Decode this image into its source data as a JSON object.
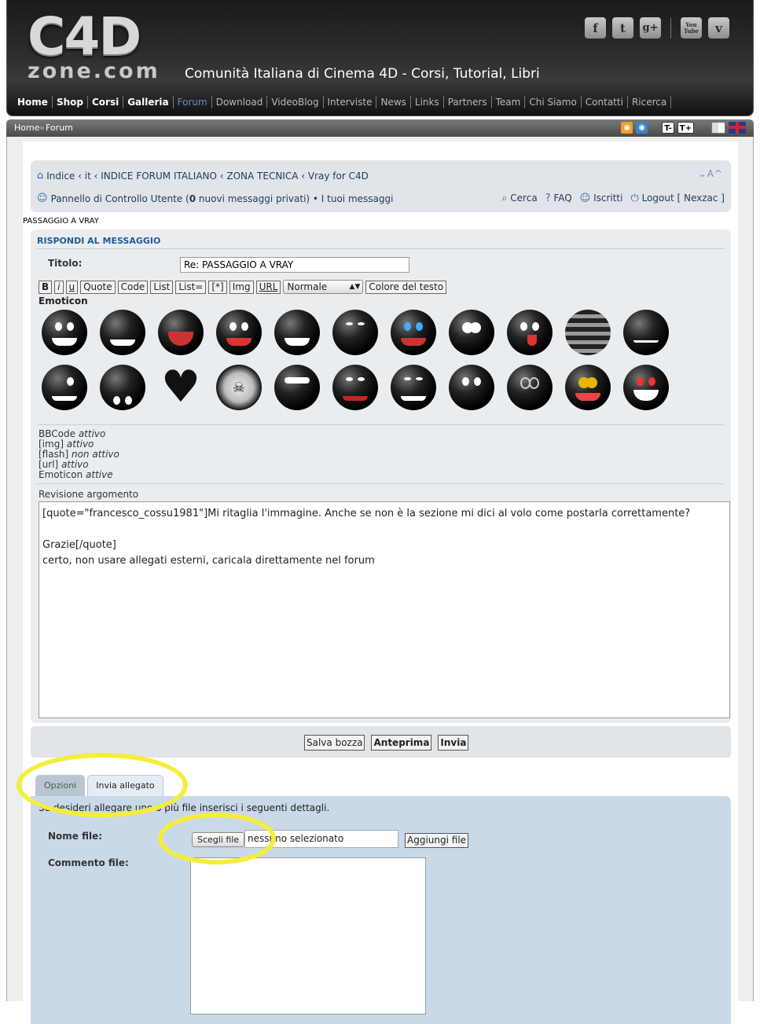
{
  "header": {
    "logo_top": "C4D",
    "logo_bottom": "zone.com",
    "tagline": "Comunità Italiana di Cinema 4D - Corsi, Tutorial, Libri",
    "social": [
      {
        "icon": "facebook-icon",
        "glyph": "f"
      },
      {
        "icon": "twitter-icon",
        "glyph": "t"
      },
      {
        "icon": "googleplus-icon",
        "glyph": "g+"
      },
      {
        "icon": "youtube-icon",
        "glyph": "You Tube"
      },
      {
        "icon": "vimeo-icon",
        "glyph": "v"
      }
    ],
    "nav": [
      "Home",
      "Shop",
      "Corsi",
      "Galleria",
      "Forum",
      "Download",
      "VideoBlog",
      "Interviste",
      "News",
      "Links",
      "Partners",
      "Team",
      "Chi Siamo",
      "Contatti",
      "Ricerca"
    ]
  },
  "crumbbar": {
    "home": "Home",
    "forum": "Forum",
    "text_smaller": "T-",
    "text_larger": "T+"
  },
  "navbar": {
    "breadcrumb": "Indice ‹ it ‹ INDICE FORUM ITALIANO ‹ ZONA TECNICA ‹ Vray for C4D",
    "fontsize_control": "⌄A^",
    "user_panel": "Pannello di Controllo Utente (",
    "pm_count": "0",
    "pm_text": " nuovi messaggi privati) • I tuoi messaggi",
    "search": "Cerca",
    "faq": "FAQ",
    "members": "Iscritti",
    "logout": "Logout [ Nexzac ]"
  },
  "topic_title": "PASSAGGIO A VRAY",
  "post": {
    "heading": "RISPONDI AL MESSAGGIO",
    "title_label": "Titolo:",
    "title_value": "Re: PASSAGGIO A VRAY",
    "bbcode": {
      "b": "B",
      "i": "i",
      "u": "u",
      "quote": "Quote",
      "code": "Code",
      "list": "List",
      "list_eq": "List=",
      "star": "[*]",
      "img": "Img",
      "url": "URL",
      "size": "Normale",
      "color": "Colore del testo"
    },
    "emoticon_label": "Emoticon",
    "status": {
      "bbcode": "BBCode",
      "bbcode_state": "attivo",
      "img": "[img]",
      "img_state": "attivo",
      "flash": "[flash]",
      "flash_state": "non attivo",
      "url": "[url]",
      "url_state": "attivo",
      "emoticon": "Emoticon",
      "emoticon_state": "attive"
    },
    "revision_label": "Revisione argomento",
    "message": "[quote=\"francesco_cossu1981\"]Mi ritaglia l'immagine. Anche se non è la sezione mi dici al volo come postarla correttamente?\n\nGrazie[/quote]\ncerto, non usare allegati esterni, caricala direttamente nel forum"
  },
  "submit": {
    "save_draft": "Salva bozza",
    "preview": "Anteprima",
    "send": "Invia"
  },
  "tabs": {
    "options": "Opzioni",
    "attach": "Invia allegato"
  },
  "attach": {
    "intro": "Se desideri allegare uno o più file inserisci i seguenti dettagli.",
    "filename_label": "Nome file:",
    "choose": "Scegli file",
    "no_file": "nessuno selezionato",
    "add_file": "Aggiungi file",
    "comment_label": "Commento file:"
  },
  "colors": {
    "highlight": "#f3ee3a",
    "link": "#1f3a5c",
    "heading": "#1f5a94",
    "attach_bg": "#c9d9e8"
  }
}
